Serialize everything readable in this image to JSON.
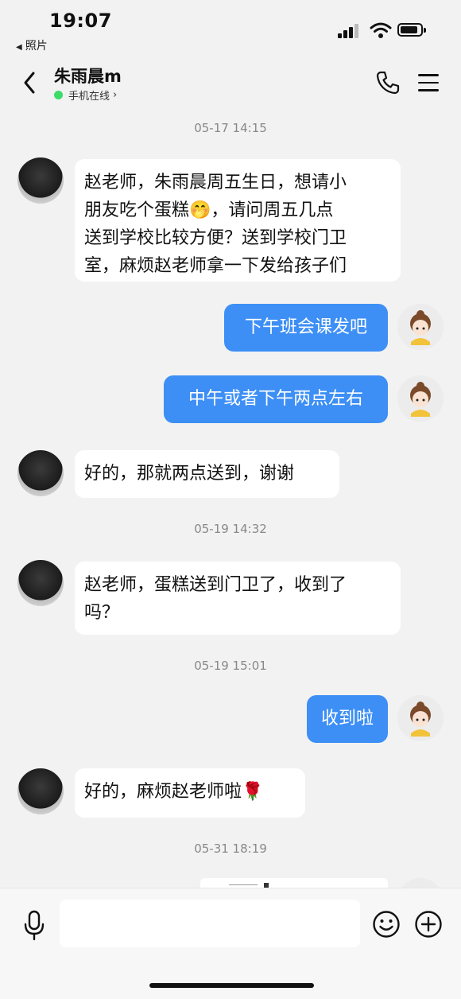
{
  "status_bar": {
    "time": "19:07",
    "back_app": "照片"
  },
  "header": {
    "contact_name": "朱雨晨m",
    "presence": "手机在线",
    "presence_color": "#3ddb68"
  },
  "messages": [
    {
      "type": "timestamp",
      "text": "05-17 14:15"
    },
    {
      "type": "peer",
      "lines": [
        "赵老师，朱雨晨周五生日，想请小",
        "朋友吃个蛋糕🤭，请问周五几点",
        "送到学校比较方便？送到学校门卫",
        "室，麻烦赵老师拿一下发给孩子们"
      ]
    },
    {
      "type": "self",
      "text": "下午班会课发吧"
    },
    {
      "type": "self",
      "text": "中午或者下午两点左右"
    },
    {
      "type": "peer",
      "lines": [
        "好的，那就两点送到，谢谢"
      ]
    },
    {
      "type": "timestamp",
      "text": "05-19 14:32"
    },
    {
      "type": "peer",
      "lines": [
        "赵老师，蛋糕送到门卫了，收到了",
        "吗？"
      ]
    },
    {
      "type": "timestamp",
      "text": "05-19 15:01"
    },
    {
      "type": "self",
      "text": "收到啦"
    },
    {
      "type": "peer",
      "lines": [
        "好的，麻烦赵老师啦🌹"
      ]
    },
    {
      "type": "timestamp",
      "text": "05-31 18:19"
    }
  ],
  "colors": {
    "self_bubble": "#3d8ff5",
    "peer_bubble": "#ffffff",
    "background": "#f2f2f2"
  },
  "input": {
    "placeholder": ""
  },
  "icons": [
    "chevron-left-icon",
    "phone-icon",
    "menu-icon",
    "microphone-icon",
    "emoji-icon",
    "plus-icon"
  ]
}
